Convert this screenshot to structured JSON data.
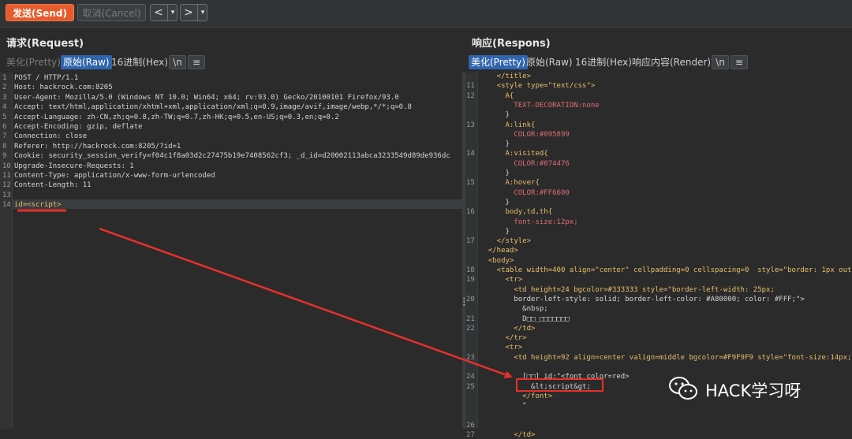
{
  "toolbar": {
    "send_label": "发送(Send)",
    "cancel_label": "取消(Cancel)",
    "back_glyph": "<",
    "forward_glyph": ">",
    "dropdown_glyph": "▾"
  },
  "request": {
    "title": "请求(Request)",
    "tabs": [
      "美化(Pretty)",
      "原始(Raw)",
      "16进制(Hex)",
      "\\n",
      "≡"
    ],
    "active_tab": "原始(Raw)",
    "lines": [
      {
        "n": "1",
        "text": "POST / HTTP/1.1"
      },
      {
        "n": "2",
        "text": "Host: hackrock.com:8205"
      },
      {
        "n": "3",
        "text": "User-Agent: Mozilla/5.0 (Windows NT 10.0; Win64; x64; rv:93.0) Gecko/20100101 Firefox/93.0"
      },
      {
        "n": "4",
        "text": "Accept: text/html,application/xhtml+xml,application/xml;q=0.9,image/avif,image/webp,*/*;q=0.8"
      },
      {
        "n": "5",
        "text": "Accept-Language: zh-CN,zh;q=0.8,zh-TW;q=0.7,zh-HK;q=0.5,en-US;q=0.3,en;q=0.2"
      },
      {
        "n": "6",
        "text": "Accept-Encoding: gzip, deflate"
      },
      {
        "n": "7",
        "text": "Connection: close"
      },
      {
        "n": "8",
        "text": "Referer: http://hackrock.com:8205/?id=1"
      },
      {
        "n": "9",
        "text": "Cookie: security_session_verify=f04c1f8a03d2c27475b19e7408562cf3; _d_id=d20002113abca3233549d89de936dc"
      },
      {
        "n": "10",
        "text": "Upgrade-Insecure-Requests: 1"
      },
      {
        "n": "11",
        "text": "Content-Type: application/x-www-form-urlencoded"
      },
      {
        "n": "12",
        "text": "Content-Length: 11"
      },
      {
        "n": "13",
        "text": ""
      },
      {
        "n": "14",
        "text": "id=<script>"
      }
    ]
  },
  "response": {
    "title": "响应(Respons)",
    "tabs": [
      "美化(Pretty)",
      "原始(Raw)",
      "16进制(Hex)",
      "响应内容(Render)",
      "\\n",
      "≡"
    ],
    "active_tab": "美化(Pretty)",
    "lines": [
      {
        "n": "",
        "text": "    </title>"
      },
      {
        "n": "11",
        "text": "    <style type=\"text/css\">"
      },
      {
        "n": "12",
        "text": "      A{"
      },
      {
        "n": "",
        "text": "        TEXT-DECORATION:none"
      },
      {
        "n": "",
        "text": "      }"
      },
      {
        "n": "13",
        "text": "      A:link{"
      },
      {
        "n": "",
        "text": "        COLOR:#095899"
      },
      {
        "n": "",
        "text": "      }"
      },
      {
        "n": "14",
        "text": "      A:visited{"
      },
      {
        "n": "",
        "text": "        COLOR:#074476"
      },
      {
        "n": "",
        "text": "      }"
      },
      {
        "n": "15",
        "text": "      A:hover{"
      },
      {
        "n": "",
        "text": "        COLOR:#FF6600"
      },
      {
        "n": "",
        "text": "      }"
      },
      {
        "n": "16",
        "text": "      body,td,th{"
      },
      {
        "n": "",
        "text": "        font-size:12px;"
      },
      {
        "n": "",
        "text": "      }"
      },
      {
        "n": "17",
        "text": "    </style>"
      },
      {
        "n": "",
        "text": "  </head>"
      },
      {
        "n": "",
        "text": "  <body>"
      },
      {
        "n": "18",
        "text": "    <table width=400 align=\"center\" cellpadding=0 cellspacing=0  style=\"border: 1px outs"
      },
      {
        "n": "19",
        "text": "      <tr>"
      },
      {
        "n": "",
        "text": "        <td height=24 bgcolor=#333333 style=\"border-left-width: 25px;"
      },
      {
        "n": "20",
        "text": "        border-left-style: solid; border-left-color: #A80000; color: #FFF;\">"
      },
      {
        "n": "",
        "text": "          &nbsp;"
      },
      {
        "n": "21",
        "text": "          D□□_□□□□□□□"
      },
      {
        "n": "22",
        "text": "        </td>"
      },
      {
        "n": "",
        "text": "      </tr>"
      },
      {
        "n": "",
        "text": "      <tr>"
      },
      {
        "n": "23",
        "text": "        <td height=92 align=center valign=middle bgcolor=#F9F9F9 style=\"font-size:14px;"
      },
      {
        "n": "",
        "text": ""
      },
      {
        "n": "24",
        "text": "          [□□] id:\"<font color=red>"
      },
      {
        "n": "25",
        "text": "            &lt;script&gt;"
      },
      {
        "n": "",
        "text": "          </font>"
      },
      {
        "n": "",
        "text": "          \""
      },
      {
        "n": "",
        "text": ""
      },
      {
        "n": "26",
        "text": ""
      },
      {
        "n": "27",
        "text": "        </td>"
      }
    ]
  },
  "watermark": {
    "text": "HACK学习呀",
    "icon": "wechat-icon"
  },
  "colors": {
    "send": "#e65b2c",
    "active_tab": "#2f65ad",
    "annotation": "#e8302a",
    "background": "#2b2b2b"
  }
}
